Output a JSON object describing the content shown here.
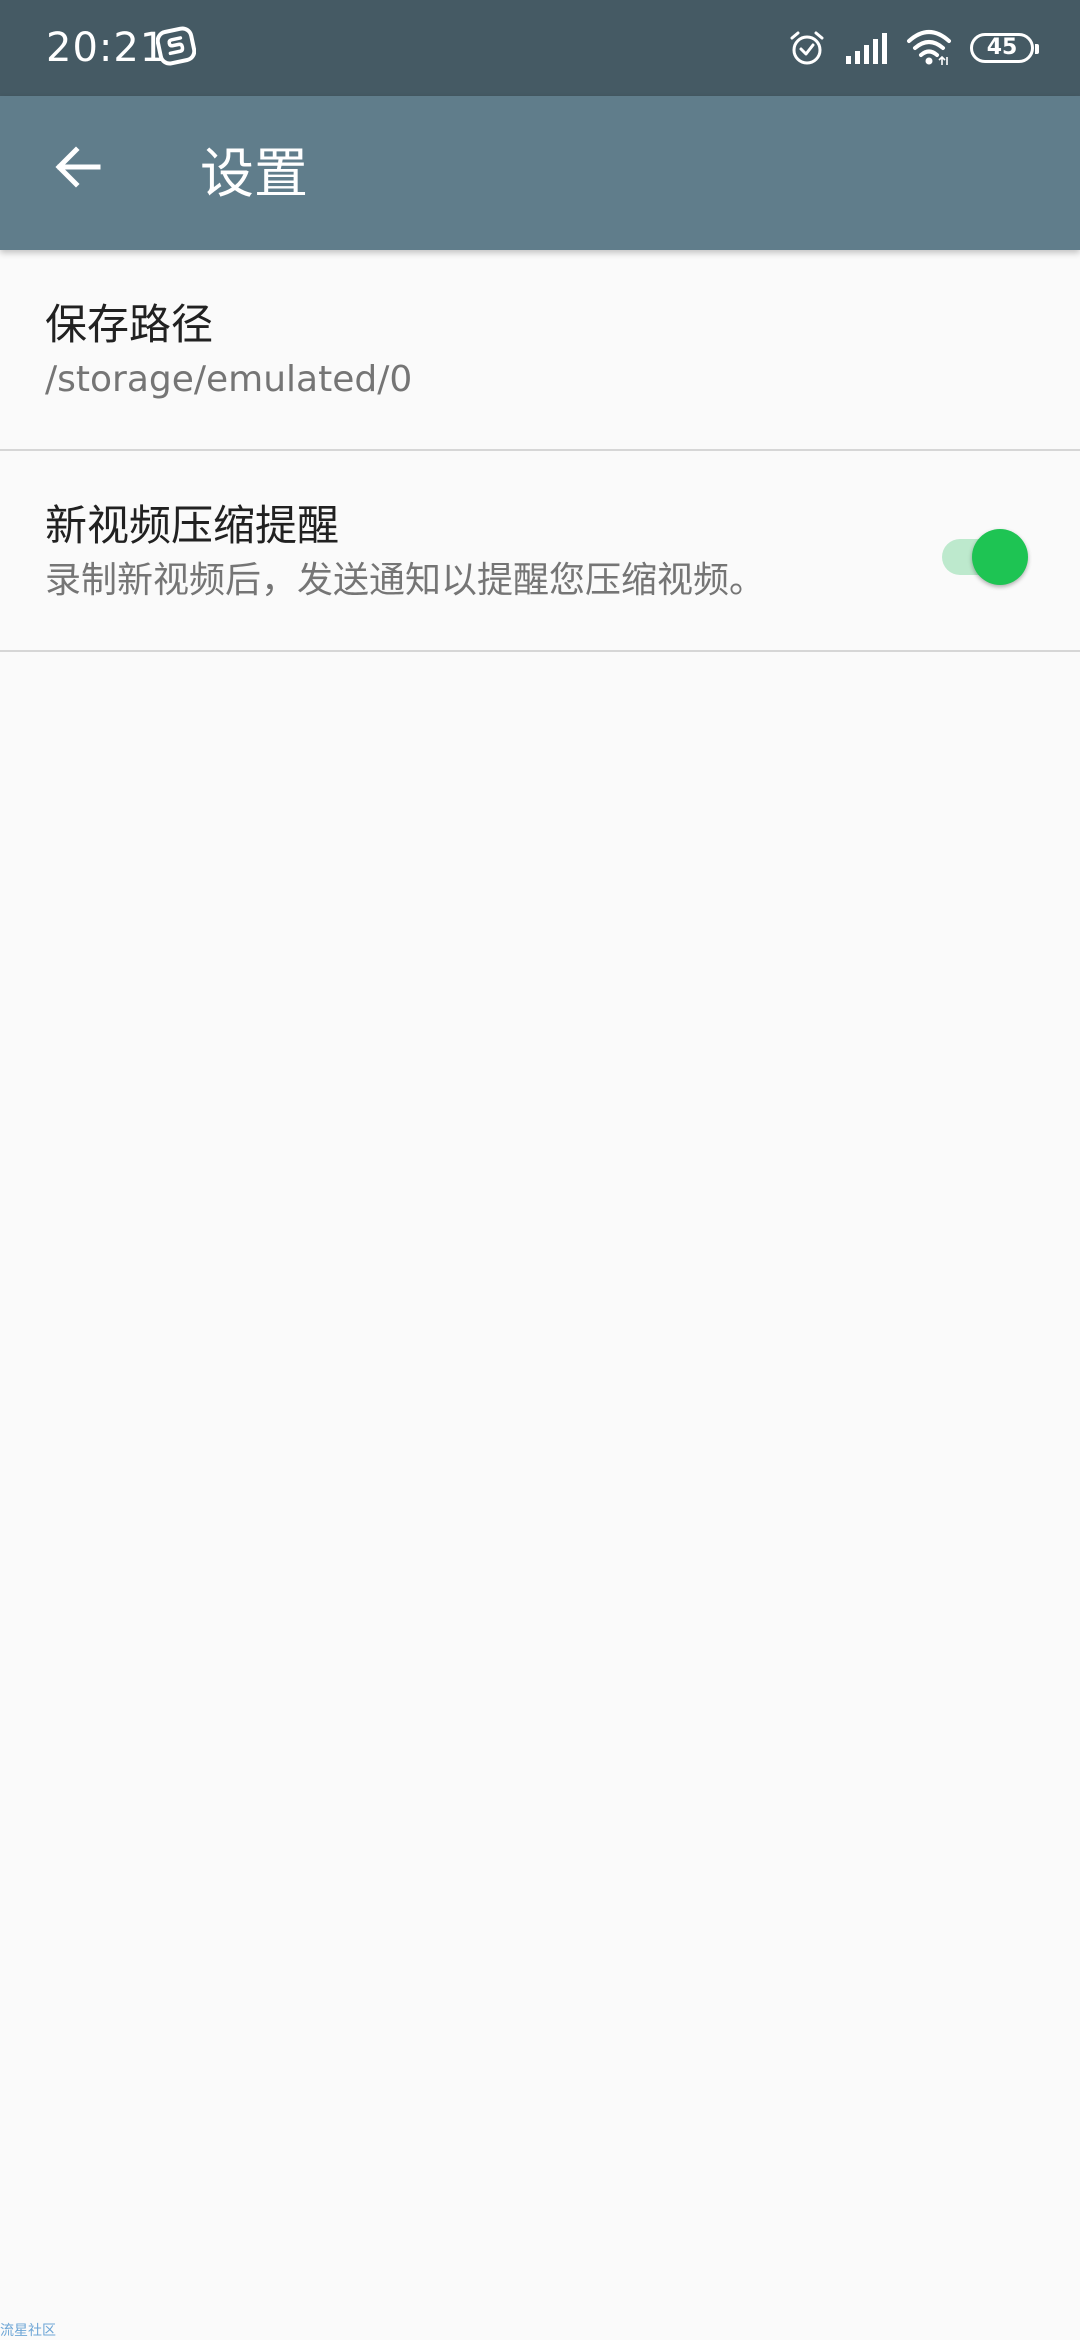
{
  "status_bar": {
    "time": "20:21",
    "battery": "45",
    "icons": [
      "app-s-icon",
      "alarm-icon",
      "signal-icon",
      "wifi-icon",
      "battery-icon"
    ]
  },
  "app_bar": {
    "title": "设置",
    "back_icon": "arrow-left-icon"
  },
  "settings": {
    "save_path": {
      "title": "保存路径",
      "summary": "/storage/emulated/0"
    },
    "compress_reminder": {
      "title": "新视频压缩提醒",
      "summary": "录制新视频后，发送通知以提醒您压缩视频。",
      "enabled": true
    }
  },
  "watermark": "流星社区",
  "colors": {
    "status_bar": "#455a64",
    "app_bar": "#607d8b",
    "switch_on": "#1ec453",
    "background": "#fafafa"
  }
}
